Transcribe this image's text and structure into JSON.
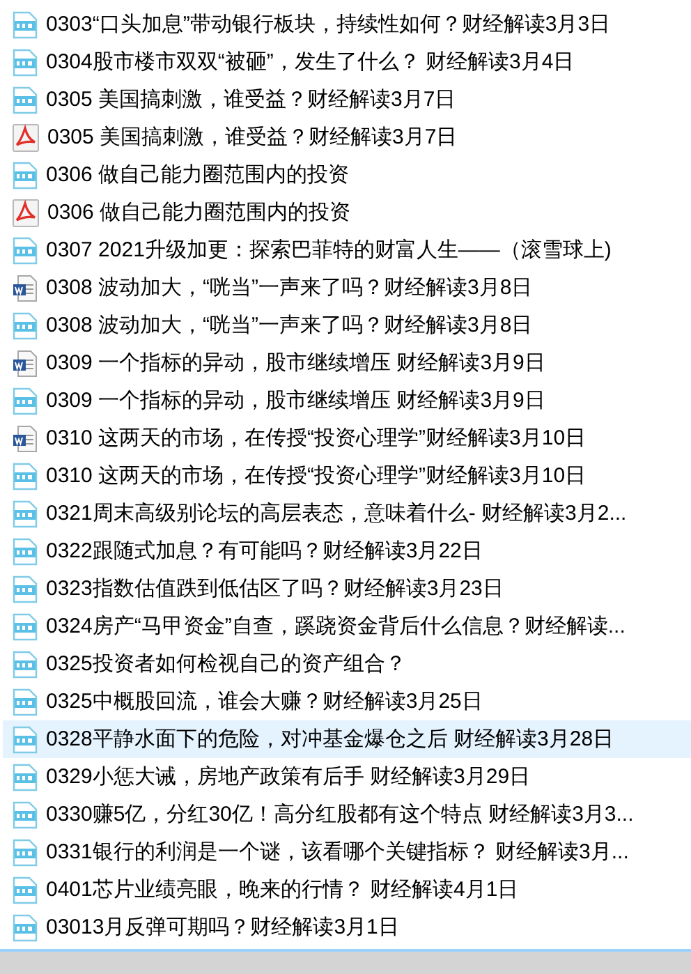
{
  "files": [
    {
      "name": "0303“口头加息”带动银行板块，持续性如何？财经解读3月3日",
      "kind": "mp3",
      "selected": false
    },
    {
      "name": "0304股市楼市双双“被砸”，发生了什么？ 财经解读3月4日",
      "kind": "mp3",
      "selected": false
    },
    {
      "name": "0305 美国搞刺激，谁受益？财经解读3月7日",
      "kind": "mp3",
      "selected": false
    },
    {
      "name": "0305 美国搞刺激，谁受益？财经解读3月7日",
      "kind": "pdf",
      "selected": false
    },
    {
      "name": "0306 做自己能力圈范围内的投资",
      "kind": "mp3",
      "selected": false
    },
    {
      "name": "0306 做自己能力圈范围内的投资",
      "kind": "pdf",
      "selected": false
    },
    {
      "name": "0307 2021升级加更：探索巴菲特的财富人生——（滚雪球上)",
      "kind": "mp3",
      "selected": false
    },
    {
      "name": "0308  波动加大，“咣当”一声来了吗？财经解读3月8日",
      "kind": "doc",
      "selected": false
    },
    {
      "name": "0308 波动加大，“咣当”一声来了吗？财经解读3月8日",
      "kind": "mp3",
      "selected": false
    },
    {
      "name": "0309 一个指标的异动，股市继续增压 财经解读3月9日",
      "kind": "doc",
      "selected": false
    },
    {
      "name": "0309 一个指标的异动，股市继续增压 财经解读3月9日",
      "kind": "mp3",
      "selected": false
    },
    {
      "name": "0310 这两天的市场，在传授“投资心理学”财经解读3月10日",
      "kind": "doc",
      "selected": false
    },
    {
      "name": "0310 这两天的市场，在传授“投资心理学”财经解读3月10日",
      "kind": "mp3",
      "selected": false
    },
    {
      "name": "0321周末高级别论坛的高层表态，意味着什么- 财经解读3月2...",
      "kind": "mp3",
      "selected": false
    },
    {
      "name": "0322跟随式加息？有可能吗？财经解读3月22日",
      "kind": "mp3",
      "selected": false
    },
    {
      "name": "0323指数估值跌到低估区了吗？财经解读3月23日",
      "kind": "mp3",
      "selected": false
    },
    {
      "name": "0324房产“马甲资金”自查，蹊跷资金背后什么信息？财经解读...",
      "kind": "mp3",
      "selected": false
    },
    {
      "name": "0325投资者如何检视自己的资产组合？",
      "kind": "mp3",
      "selected": false
    },
    {
      "name": "0325中概股回流，谁会大赚？财经解读3月25日",
      "kind": "mp3",
      "selected": false
    },
    {
      "name": "0328平静水面下的危险，对冲基金爆仓之后 财经解读3月28日",
      "kind": "mp3",
      "selected": true
    },
    {
      "name": "0329小惩大诫，房地产政策有后手 财经解读3月29日",
      "kind": "mp3",
      "selected": false
    },
    {
      "name": "0330赚5亿，分红30亿！高分红股都有这个特点 财经解读3月3...",
      "kind": "mp3",
      "selected": false
    },
    {
      "name": "0331银行的利润是一个谜，该看哪个关键指标？ 财经解读3月...",
      "kind": "mp3",
      "selected": false
    },
    {
      "name": "0401芯片业绩亮眼，晚来的行情？ 财经解读4月1日",
      "kind": "mp3",
      "selected": false
    },
    {
      "name": "03013月反弹可期吗？财经解读3月1日",
      "kind": "mp3",
      "selected": false
    }
  ]
}
